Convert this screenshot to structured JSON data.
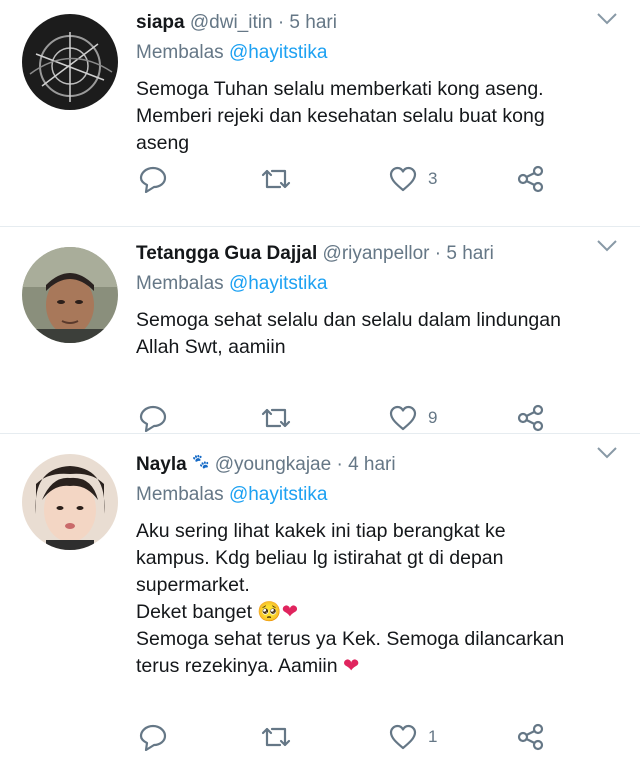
{
  "tweets": [
    {
      "name": "siapa",
      "handle": "@dwi_itin",
      "time": "5 hari",
      "reply_prefix": "Membalas",
      "reply_to": "@hayitstika",
      "lines": [
        "Semoga Tuhan selalu memberkati kong aseng.",
        "Memberi rejeki dan kesehatan selalu buat kong",
        "aseng"
      ],
      "likes": "3"
    },
    {
      "name": "Tetangga Gua Dajjal",
      "handle": "@riyanpellor",
      "time": "5 hari",
      "reply_prefix": "Membalas",
      "reply_to": "@hayitstika",
      "lines": [
        "Semoga sehat selalu dan selalu dalam lindungan",
        "Allah Swt, aamiin"
      ],
      "likes": "9"
    },
    {
      "name": "Nayla",
      "name_emoji": "🐾",
      "handle": "@youngkajae",
      "time": "4 hari",
      "reply_prefix": "Membalas",
      "reply_to": "@hayitstika",
      "lines": [
        "Aku sering lihat kakek ini tiap berangkat ke",
        "kampus. Kdg beliau lg istirahat gt di depan",
        "supermarket.",
        "Deket banget 🥺",
        "Semoga sehat terus ya Kek. Semoga dilancarkan",
        "terus rezekinya. Aamiin"
      ],
      "heart_emoji": "❤",
      "likes": "1"
    }
  ],
  "separator": "·",
  "icons": {
    "reply": "reply-icon",
    "retweet": "retweet-icon",
    "like": "heart-icon",
    "share": "share-icon",
    "menu": "chevron-down-icon"
  },
  "colors": {
    "text": "#14171a",
    "muted": "#657786",
    "link": "#1da1f2",
    "divider": "#e6ecf0",
    "emoji_heart": "#e0245e"
  }
}
